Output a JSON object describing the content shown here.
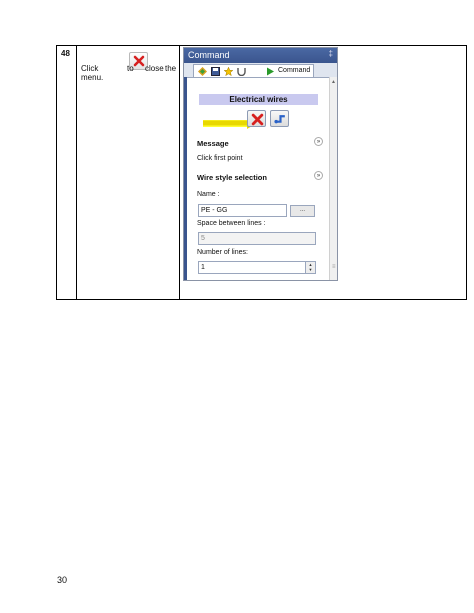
{
  "step": {
    "number": "48",
    "instruction_word1": "Click",
    "instruction_word2": "to",
    "instruction_word3": "close",
    "instruction_word4": "the",
    "instruction_word5": "menu."
  },
  "panel": {
    "title": "Command",
    "pin_glyph": "‡",
    "tab_label": "Command",
    "section_title": "Electrical wires",
    "message_heading": "Message",
    "message_text": "Click first point",
    "wire_style_heading": "Wire style selection",
    "name_label": "Name :",
    "name_value": "PE - GG",
    "browse_label": "...",
    "space_label": "Space between lines :",
    "space_value": "5",
    "lines_label": "Number of lines:",
    "lines_value": "1",
    "collapse_glyph": "»"
  },
  "icons": {
    "close": "red-x-icon",
    "wire": "wire-tool-icon",
    "highlight_color": "#ffff33",
    "section_color": "#c9c9ef",
    "title_color": "#3a558e"
  },
  "footer": {
    "page_number": "30"
  }
}
